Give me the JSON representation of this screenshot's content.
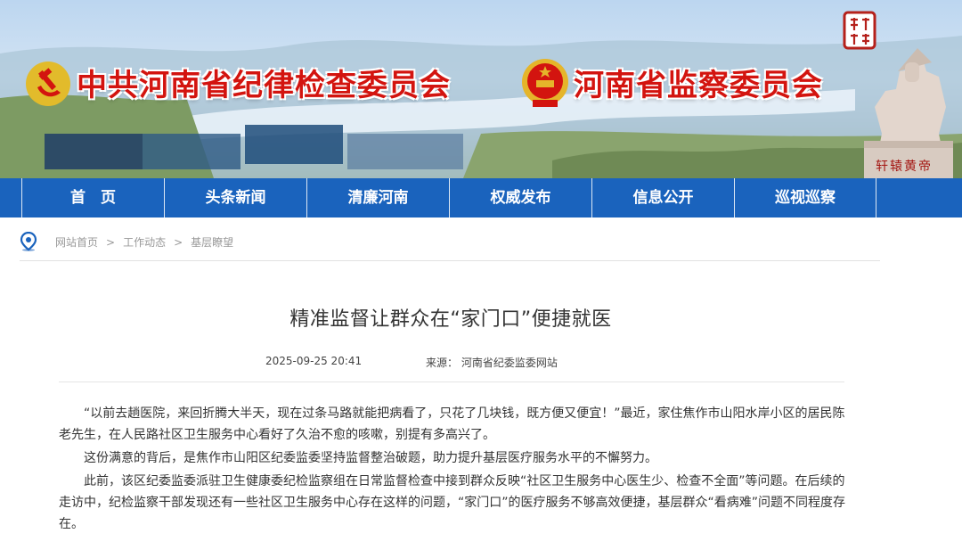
{
  "header": {
    "org_left": "中共河南省纪律检查委员会",
    "org_right": "河南省监察委员会",
    "statue_caption": "轩辕黄帝",
    "colors": {
      "title_red": "#d3140f",
      "nav_blue": "#1a63bd"
    }
  },
  "nav": {
    "items": [
      {
        "label": "首　页"
      },
      {
        "label": "头条新闻"
      },
      {
        "label": "清廉河南"
      },
      {
        "label": "权威发布"
      },
      {
        "label": "信息公开"
      },
      {
        "label": "巡视巡察"
      }
    ]
  },
  "breadcrumb": {
    "icon": "location-pin-icon",
    "items": [
      {
        "label": "网站首页"
      },
      {
        "label": "工作动态"
      },
      {
        "label": "基层瞭望"
      }
    ],
    "separator": ">"
  },
  "article": {
    "title": "精准监督让群众在“家门口”便捷就医",
    "date": "2025-09-25 20:41",
    "source": "来源： 河南省纪委监委网站",
    "paragraphs": [
      "“以前去趟医院，来回折腾大半天，现在过条马路就能把病看了，只花了几块钱，既方便又便宜！”最近，家住焦作市山阳水岸小区的居民陈老先生，在人民路社区卫生服务中心看好了久治不愈的咳嗽，别提有多高兴了。",
      "这份满意的背后，是焦作市山阳区纪委监委坚持监督整治破题，助力提升基层医疗服务水平的不懈努力。",
      "此前，该区纪委监委派驻卫生健康委纪检监察组在日常监督检查中接到群众反映“社区卫生服务中心医生少、检查不全面”等问题。在后续的走访中，纪检监察干部发现还有一些社区卫生服务中心存在这样的问题，“家门口”的医疗服务不够高效便捷，基层群众“看病难”问题不同程度存在。"
    ]
  }
}
